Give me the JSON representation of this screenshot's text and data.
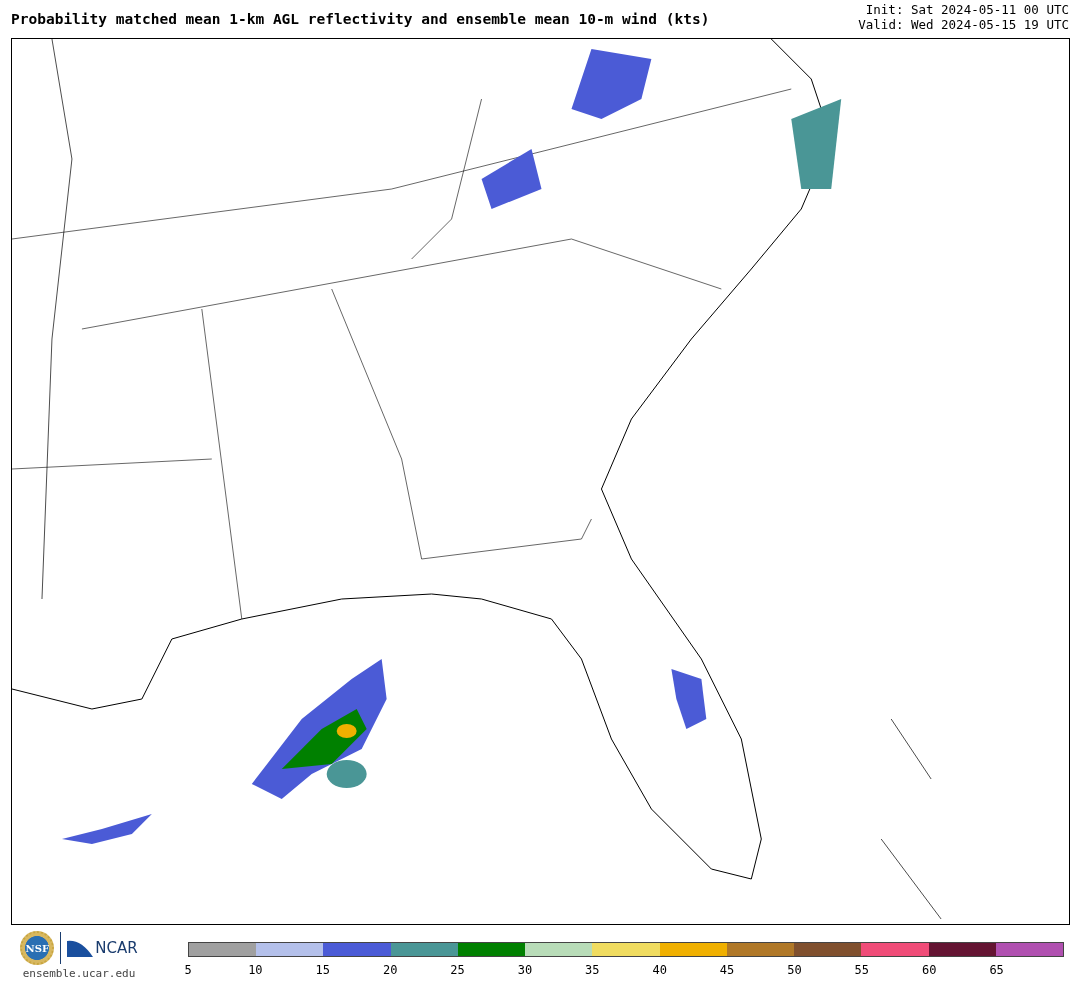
{
  "title": "Probability matched mean 1-km AGL reflectivity and ensemble mean 10-m wind (kts)",
  "init": "Init: Sat 2024-05-11 00 UTC",
  "valid": "Valid: Wed 2024-05-15 19 UTC",
  "logos": {
    "nsf": "NSF",
    "ncar": "NCAR",
    "site": "ensemble.ucar.edu"
  },
  "legend": [
    {
      "color": "#a0a0a0",
      "label": "5"
    },
    {
      "color": "#b4c0ea",
      "label": "10"
    },
    {
      "color": "#4b5bd6",
      "label": "15"
    },
    {
      "color": "#4a9696",
      "label": "20"
    },
    {
      "color": "#008000",
      "label": "25"
    },
    {
      "color": "#b8dcb8",
      "label": "30"
    },
    {
      "color": "#f0dc60",
      "label": "35"
    },
    {
      "color": "#f0b000",
      "label": "40"
    },
    {
      "color": "#b07828",
      "label": "45"
    },
    {
      "color": "#80502e",
      "label": "50"
    },
    {
      "color": "#f04c78",
      "label": "55"
    },
    {
      "color": "#641432",
      "label": "60"
    },
    {
      "color": "#b050b0",
      "label": "65"
    }
  ]
}
